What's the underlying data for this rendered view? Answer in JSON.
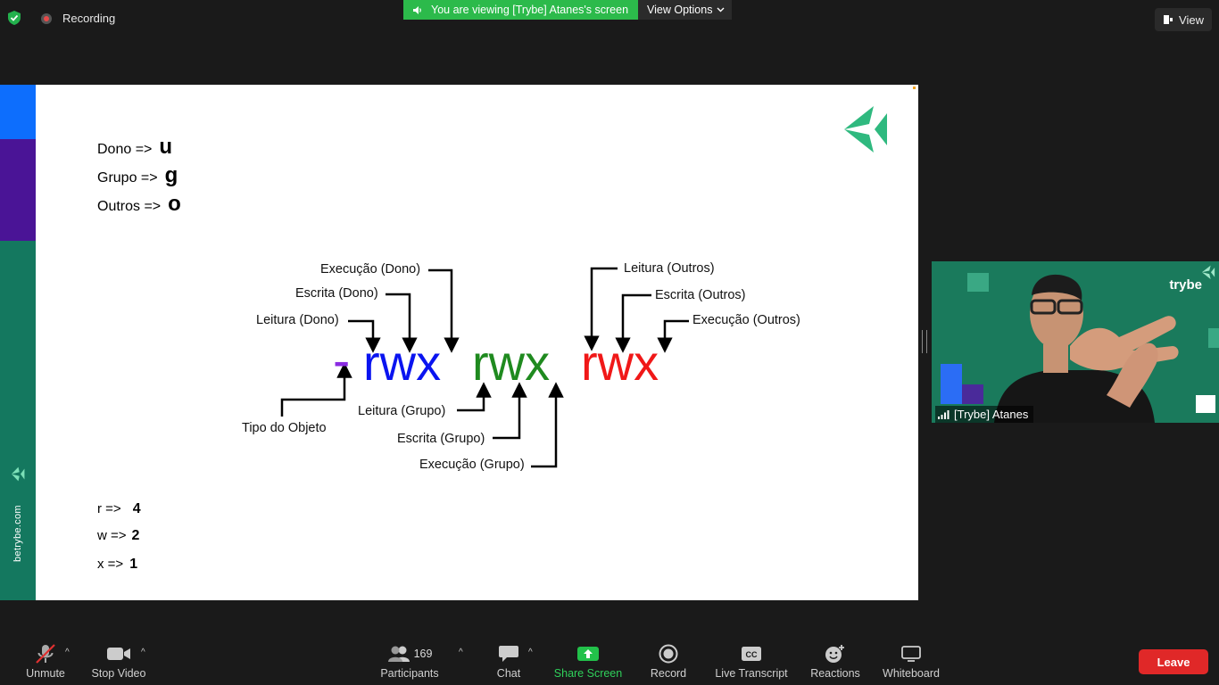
{
  "top_bar": {
    "recording_label": "Recording",
    "viewing_notice": "You are viewing [Trybe] Atanes's screen",
    "view_options_label": "View Options",
    "view_label": "View"
  },
  "slide": {
    "side_url": "betrybe.com",
    "permission_owners": [
      {
        "label": "Dono =>",
        "letter": "u"
      },
      {
        "label": "Grupo  =>",
        "letter": "g"
      },
      {
        "label": "Outros =>",
        "letter": "o"
      }
    ],
    "diagram": {
      "type_char": "-",
      "owner_perms": "rwx",
      "group_perms": "rwx",
      "others_perms": "rwx",
      "colors": {
        "type": "#8a2be2",
        "owner": "#0a14f0",
        "group": "#1f8a1f",
        "others": "#f01818"
      },
      "labels": {
        "exec_dono": "Execução (Dono)",
        "escrita_dono": "Escrita (Dono)",
        "leitura_dono": "Leitura (Dono)",
        "leitura_outros": "Leitura (Outros)",
        "escrita_outros": "Escrita (Outros)",
        "exec_outros": "Execução (Outros)",
        "tipo_objeto": "Tipo do Objeto",
        "leitura_grupo": "Leitura (Grupo)",
        "escrita_grupo": "Escrita (Grupo)",
        "exec_grupo": "Execução (Grupo)"
      }
    },
    "permission_values": [
      {
        "label": "r =>",
        "value": "4"
      },
      {
        "label": "w  =>",
        "value": "2"
      },
      {
        "label": "x =>",
        "value": "1"
      }
    ]
  },
  "video": {
    "brand": "trybe",
    "participant_name": "[Trybe] Atanes"
  },
  "toolbar": {
    "unmute": "Unmute",
    "stop_video": "Stop Video",
    "participants": "Participants",
    "participants_count": "169",
    "chat": "Chat",
    "share_screen": "Share Screen",
    "record": "Record",
    "live_transcript": "Live Transcript",
    "reactions": "Reactions",
    "whiteboard": "Whiteboard",
    "leave": "Leave",
    "cc_icon_text": "CC"
  }
}
